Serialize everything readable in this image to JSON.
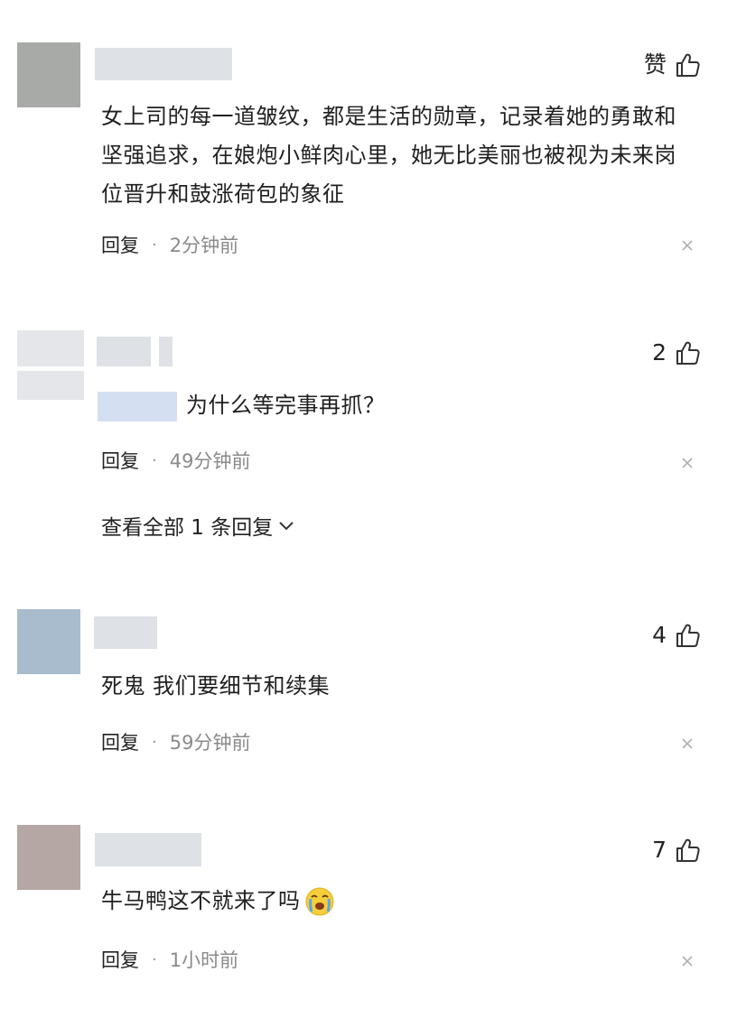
{
  "comments": [
    {
      "likes": "赞",
      "text": "女上司的每一道皱纹，都是生活的勋章，记录着她的勇敢和坚强追求，在娘炮小鲜肉心里，她无比美丽也被视为未来岗位晋升和鼓涨荷包的象征",
      "reply_label": "回复",
      "separator": "·",
      "time": "2分钟前"
    },
    {
      "likes": "2",
      "text": "为什么等完事再抓？",
      "reply_label": "回复",
      "separator": "·",
      "time": "49分钟前",
      "view_all": "查看全部 1 条回复"
    },
    {
      "likes": "4",
      "text": "死鬼 我们要细节和续集",
      "reply_label": "回复",
      "separator": "·",
      "time": "59分钟前"
    },
    {
      "likes": "7",
      "text": "牛马鸭这不就来了吗",
      "reply_label": "回复",
      "separator": "·",
      "time": "1小时前"
    }
  ],
  "colors": {
    "avatar_1": "#a7aaa6",
    "avatar_3": "#a9bccd",
    "avatar_4": "#b5a7a3",
    "name_placeholder": "#dee1e6",
    "mention_placeholder": "#d5dff2",
    "time_text": "#8a8a8a"
  },
  "icons": [
    "thumbs-up-icon",
    "close-icon",
    "chevron-down-icon",
    "crying-face-emoji-icon"
  ]
}
